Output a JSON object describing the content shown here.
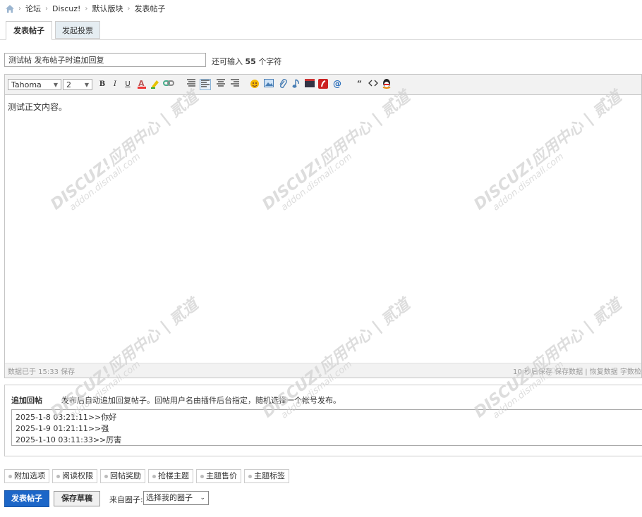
{
  "breadcrumb": {
    "items": [
      "论坛",
      "Discuz!",
      "默认版块",
      "发表帖子"
    ]
  },
  "tabs": [
    "发表帖子",
    "发起投票"
  ],
  "subject": {
    "value": "测试帖 发布帖子时追加回复",
    "remaining_prefix": "还可输入",
    "remaining_count": "55",
    "remaining_suffix": "个字符"
  },
  "editor": {
    "font": "Tahoma",
    "size": "2",
    "buttons": [
      "B",
      "I",
      "U"
    ],
    "content": "测试正文内容。",
    "status_left": "数据已于 15:33 保存",
    "status_right": "10 秒后保存 保存数据 | 恢复数据    字数检"
  },
  "extra_reply": {
    "title": "追加回帖",
    "description": "发布后自动追加回复帖子。回帖用户名由插件后台指定，随机选择一个帐号发布。",
    "lines": [
      "2025-1-8 03:21:11>>你好",
      "2025-1-9 01:21:11>>强",
      "2025-1-10 03:11:33>>厉害"
    ]
  },
  "options": [
    "附加选项",
    "阅读权限",
    "回帖奖励",
    "抢楼主题",
    "主题售价",
    "主题标签"
  ],
  "actions": {
    "submit": "发表帖子",
    "draft": "保存草稿",
    "circle_label": "来自圈子:",
    "circle_selected": "选择我的圈子"
  },
  "watermark": {
    "brand": "DISCUZ!应用中心 | 贰道",
    "site": "addon.dismall.com"
  },
  "colors": {
    "primary": "#1c66c7",
    "tab_inactive": "#e5edf2"
  }
}
